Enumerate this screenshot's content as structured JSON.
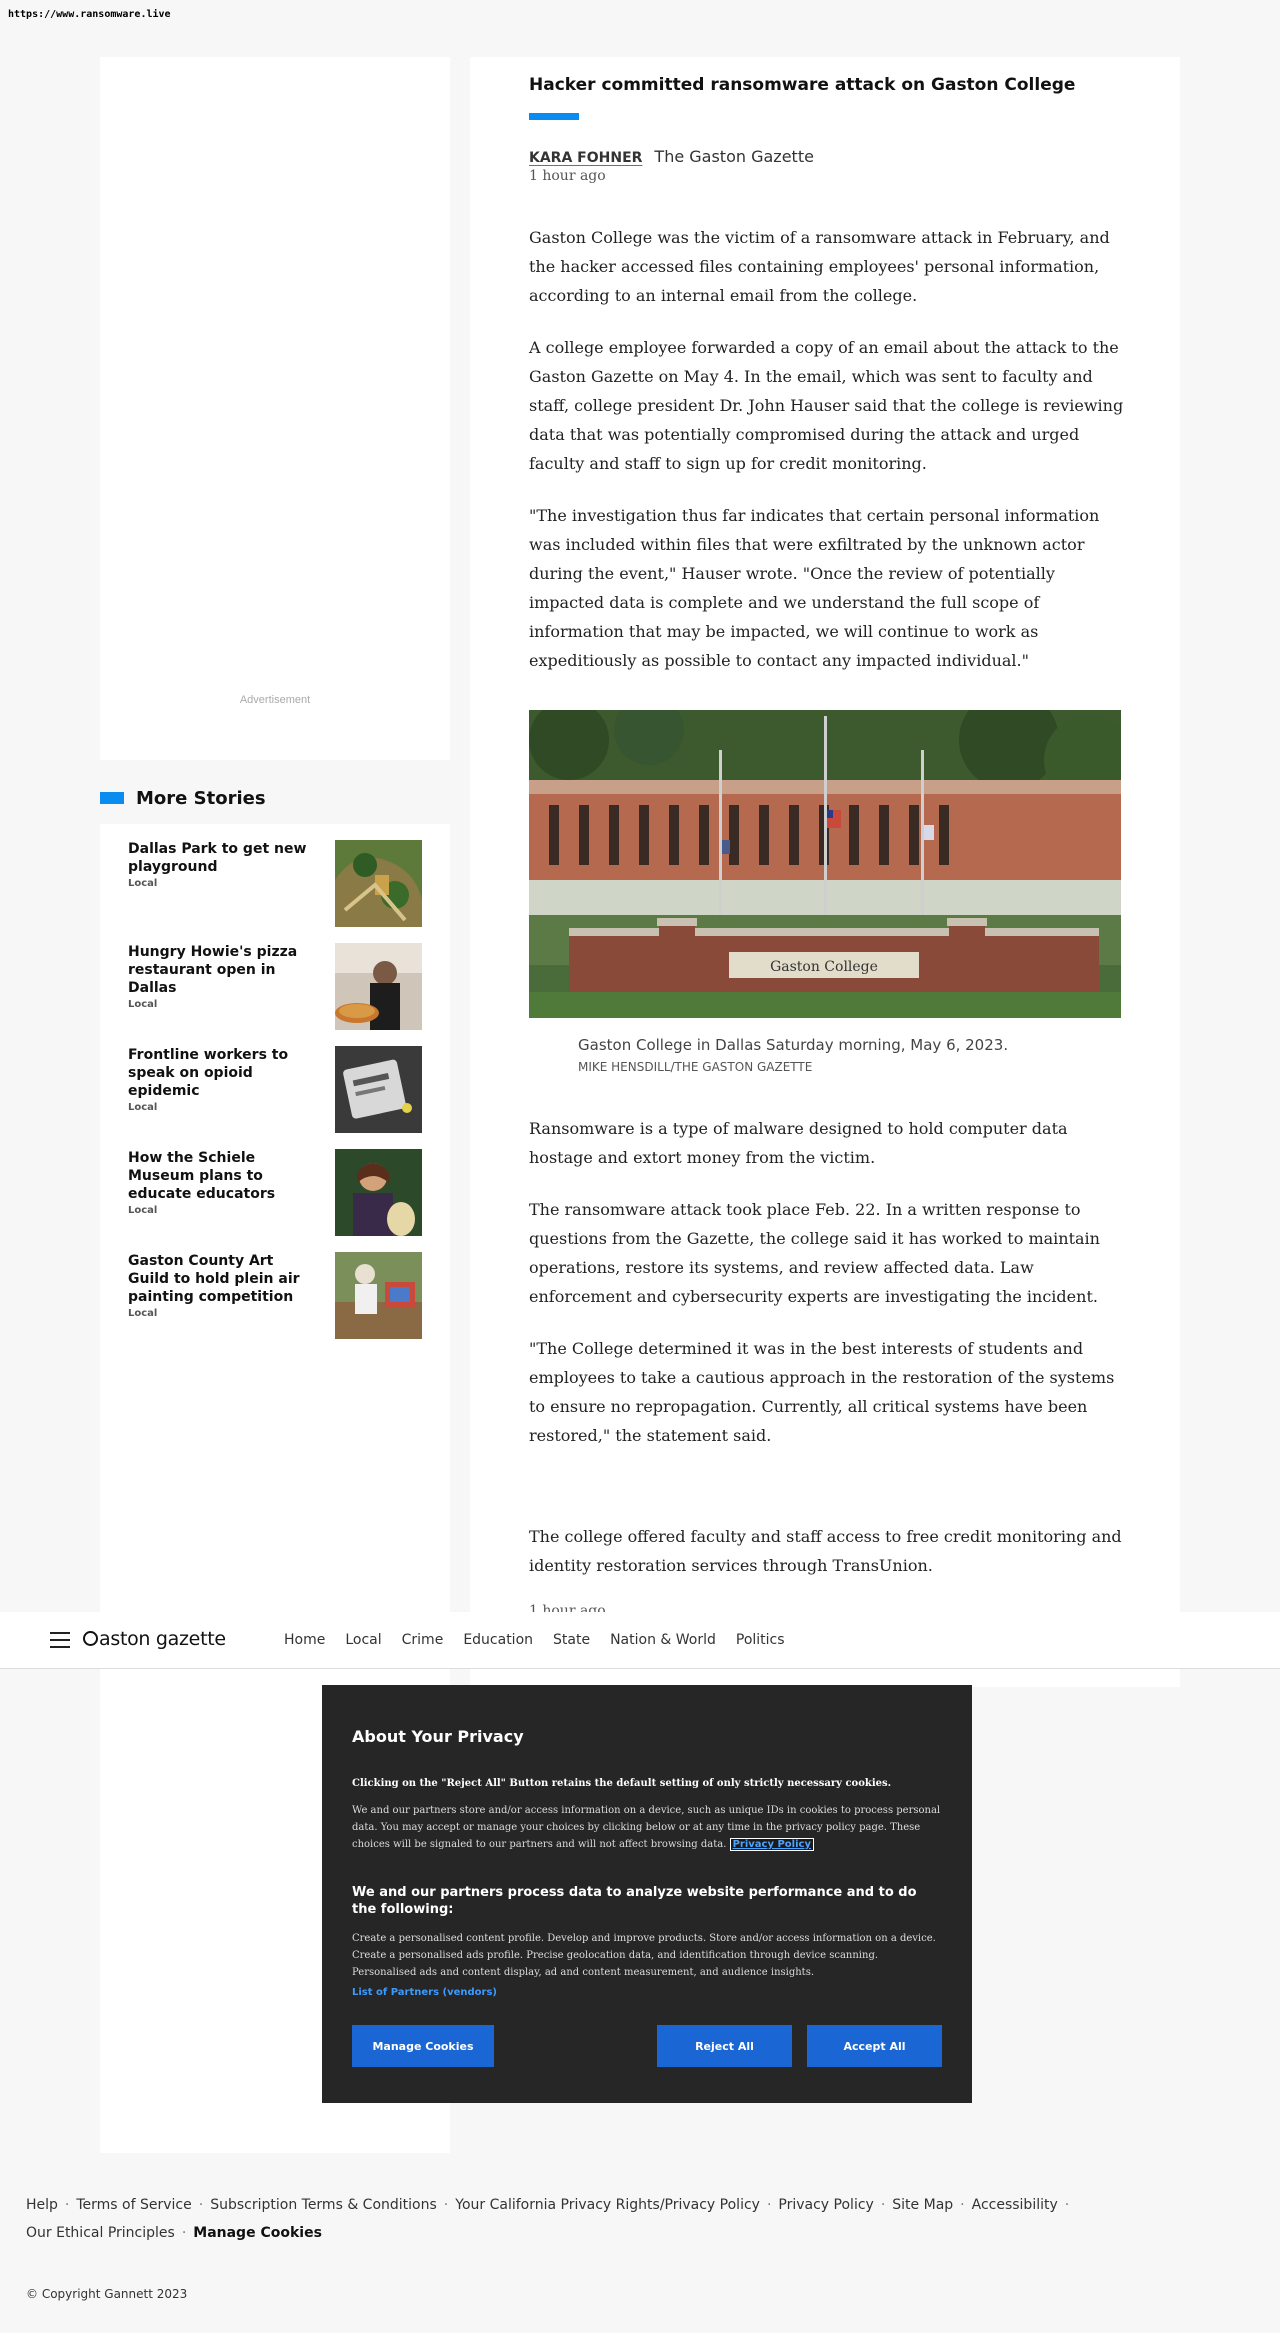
{
  "browser": {
    "url": "https://www.ransomware.live"
  },
  "sidebar": {
    "ad_label": "Advertisement",
    "more_stories_title": "More Stories",
    "stories": [
      {
        "title": "Dallas Park to get new playground",
        "tag": "Local",
        "thumb": "park-illustration"
      },
      {
        "title": "Hungry Howie's pizza restaurant open in Dallas",
        "tag": "Local",
        "thumb": "pizza-photo"
      },
      {
        "title": "Frontline workers to speak on opioid epidemic",
        "tag": "Local",
        "thumb": "pills-photo"
      },
      {
        "title": "How the Schiele Museum plans to educate educators",
        "tag": "Local",
        "thumb": "museum-photo"
      },
      {
        "title": "Gaston County Art Guild to hold plein air painting competition",
        "tag": "Local",
        "thumb": "painter-photo"
      }
    ]
  },
  "article": {
    "headline": "Hacker committed ransomware attack on Gaston College",
    "author": "KARA FOHNER",
    "publication": "The Gaston Gazette",
    "timestamp": "1 hour ago",
    "paragraphs_top": [
      "Gaston College was the victim of a ransomware attack in February, and the hacker accessed files containing employees' personal information, according to an internal email from the college.",
      "A college employee forwarded a copy of an email about the attack to the Gaston Gazette on May 4. In the email, which was sent to faculty and staff, college president Dr. John Hauser said that the college is reviewing data that was potentially compromised during the attack and urged faculty and staff to sign up for credit monitoring.",
      "\"The investigation thus far indicates that certain personal information was included within files that were exfiltrated by the unknown actor during the event,\" Hauser wrote. \"Once the review of potentially impacted data is complete and we understand the full scope of information that may be impacted, we will continue to work as expeditiously as possible to contact any impacted individual.\""
    ],
    "photo": {
      "sign_text": "Gaston College",
      "caption": "Gaston College in Dallas Saturday morning, May 6, 2023.",
      "credit": "Mike Hensdill/The Gaston Gazette"
    },
    "paragraphs_bottom": [
      "Ransomware is a type of malware designed to hold computer data hostage and extort money from the victim.",
      "The ransomware attack took place Feb. 22. In a written response to questions from the Gazette, the college said it has worked to maintain operations, restore its systems, and review affected data. Law enforcement and cybersecurity experts are investigating the incident.",
      "\"The College determined it was in the best interests of students and employees to take a cautious approach in the restoration of the systems to ensure no repropagation. Currently, all critical systems have been restored,\" the statement said."
    ],
    "paragraph_final": "The college offered faculty and staff access to free credit monitoring and identity restoration services through TransUnion.",
    "timestamp_bottom": "1 hour ago"
  },
  "nav": {
    "logo_text": "aston gazette",
    "links": [
      "Home",
      "Local",
      "Crime",
      "Education",
      "State",
      "Nation & World",
      "Politics"
    ]
  },
  "privacy": {
    "title": "About Your Privacy",
    "reject_note": "Clicking on the \"Reject All\" Button retains the default setting of only strictly necessary cookies.",
    "description": "We and our partners store and/or access information on a device, such as unique IDs in cookies to process personal data. You may accept or manage your choices by clicking below or at any time in the privacy policy page. These choices will be signaled to our partners and will not affect browsing data.",
    "policy_link": "Privacy Policy",
    "purposes_title": "We and our partners process data to analyze website performance and to do the following:",
    "purposes": "Create a personalised content profile. Develop and improve products. Store and/or access information on a device. Create a personalised ads profile. Precise geolocation data, and identification through device scanning. Personalised ads and content display, ad and content measurement, and audience insights.",
    "vendors_link": "List of Partners (vendors)",
    "manage_label": "Manage Cookies",
    "reject_label": "Reject All",
    "accept_label": "Accept All"
  },
  "footer": {
    "links": [
      "Help",
      "Terms of Service",
      "Subscription Terms & Conditions",
      "Your California Privacy Rights/Privacy Policy",
      "Privacy Policy",
      "Site Map",
      "Accessibility",
      "Our Ethical Principles"
    ],
    "manage_cookies": "Manage Cookies",
    "copyright": "© Copyright Gannett 2023"
  },
  "colors": {
    "accent": "#0a8bf0",
    "button": "#1a66d4",
    "modal_bg": "#262626"
  }
}
